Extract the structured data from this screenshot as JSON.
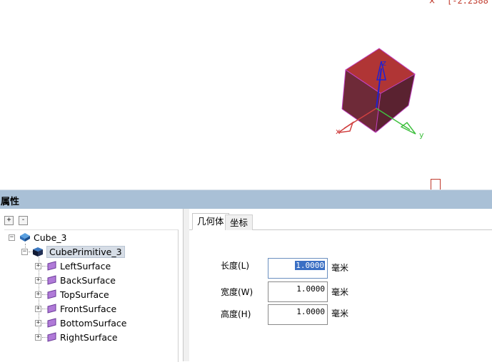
{
  "viewport": {
    "coord_readout": "[-2.2388",
    "axis_labels": {
      "x": "x",
      "y": "y",
      "z": "z"
    },
    "colors": {
      "cube_top": "#b03a3a",
      "cube_side": "#7a3040",
      "edge": "#c040c0",
      "x_axis": "#d04040",
      "y_axis": "#40c040",
      "z_axis": "#2020d0"
    }
  },
  "panel": {
    "title": "属性"
  },
  "tree": {
    "expand_button": "+",
    "collapse_button": "-",
    "root": {
      "label": "Cube_3",
      "icon": "cube-icon"
    },
    "primitive": {
      "label": "CubePrimitive_3",
      "icon": "cube-primitive-icon"
    },
    "surfaces": [
      {
        "label": "LeftSurface"
      },
      {
        "label": "BackSurface"
      },
      {
        "label": "TopSurface"
      },
      {
        "label": "FrontSurface"
      },
      {
        "label": "BottomSurface"
      },
      {
        "label": "RightSurface"
      }
    ]
  },
  "tabs": [
    {
      "label": "几何体",
      "active": true
    },
    {
      "label": "坐标",
      "active": false
    }
  ],
  "form": {
    "length": {
      "label": "长度(L)",
      "value": "1.0000",
      "unit": "毫米"
    },
    "width": {
      "label": "宽度(W)",
      "value": "1.0000",
      "unit": "毫米"
    },
    "height": {
      "label": "高度(H)",
      "value": "1.0000",
      "unit": "毫米"
    }
  }
}
